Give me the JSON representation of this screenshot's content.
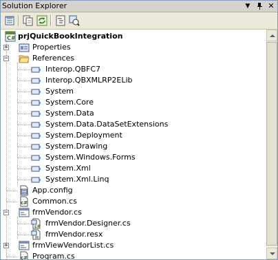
{
  "window": {
    "title": "Solution Explorer",
    "menu_glyph": "▼",
    "pin_glyph": "✈",
    "close_glyph": "✕"
  },
  "toolbar": {
    "buttons": [
      "properties-icon",
      "show-all-files-icon",
      "refresh-icon",
      "view-code-icon",
      "view-designer-icon"
    ]
  },
  "tree": {
    "root": "prjQuickBookIntegration",
    "properties": "Properties",
    "references": "References",
    "reference_items": [
      "Interop.QBFC7",
      "Interop.QBXMLRP2ELib",
      "System",
      "System.Core",
      "System.Data",
      "System.Data.DataSetExtensions",
      "System.Deployment",
      "System.Drawing",
      "System.Windows.Forms",
      "System.Xml",
      "System.Xml.Linq"
    ],
    "app_config": "App.config",
    "common": "Common.cs",
    "frm_vendor": "frmVendor.cs",
    "frm_vendor_designer": "frmVendor.Designer.cs",
    "frm_vendor_resx": "frmVendor.resx",
    "frm_view_vendor_list": "frmViewVendorList.cs",
    "program": "Program.cs",
    "expand_glyph": "+",
    "collapse_glyph": "−"
  },
  "colors": {
    "border": "#7f9db9",
    "titlebar": "#d6d3ce",
    "toolbar": "#ece9d8",
    "folder": "#e8c65a",
    "reference": "#6b8fd0"
  }
}
